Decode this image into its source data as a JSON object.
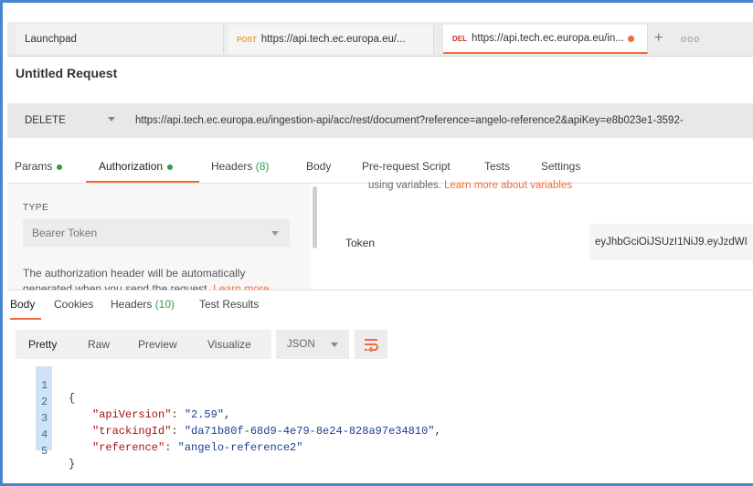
{
  "tabs": {
    "launchpad": "Launchpad",
    "post_method": "POST",
    "post_url": "https://api.tech.ec.europa.eu/...",
    "del_method": "DEL",
    "del_url": "https://api.tech.ec.europa.eu/in...",
    "new_tab_symbol": "+",
    "more_symbol": "ooo"
  },
  "request": {
    "title": "Untitled Request",
    "method": "DELETE",
    "url": "https://api.tech.ec.europa.eu/ingestion-api/acc/rest/document?reference=angelo-reference2&apiKey=e8b023e1-3592-"
  },
  "request_tabs": {
    "params": "Params",
    "authorization": "Authorization",
    "headers": "Headers",
    "headers_count": "(8)",
    "body": "Body",
    "prerequest": "Pre-request Script",
    "tests": "Tests",
    "settings": "Settings"
  },
  "auth": {
    "type_label": "TYPE",
    "type_value": "Bearer Token",
    "description": "The authorization header will be automatically generated when you send the request.",
    "description_link": "Learn more",
    "variables_text": "using variables.",
    "variables_link": "Learn more about variables",
    "token_label": "Token",
    "token_value": "eyJhbGciOiJSUzI1NiJ9.eyJzdWI"
  },
  "response_tabs": {
    "body": "Body",
    "cookies": "Cookies",
    "headers": "Headers",
    "headers_count": "(10)",
    "test_results": "Test Results"
  },
  "response_toolbar": {
    "pretty": "Pretty",
    "raw": "Raw",
    "preview": "Preview",
    "visualize": "Visualize",
    "format": "JSON"
  },
  "response_body": {
    "line_numbers": [
      "1",
      "2",
      "3",
      "4",
      "5"
    ],
    "open_brace": "{",
    "close_brace": "}",
    "fields": [
      {
        "key": "\"apiVersion\"",
        "value": "\"2.59\"",
        "sep": ",",
        "colon": ": "
      },
      {
        "key": "\"trackingId\"",
        "value": "\"da71b80f-68d9-4e79-8e24-828a97e34810\"",
        "sep": ",",
        "colon": ": "
      },
      {
        "key": "\"reference\"",
        "value": "\"angelo-reference2\"",
        "sep": "",
        "colon": ": "
      }
    ]
  },
  "colors": {
    "accent": "#f26b3a",
    "status_green": "#2e9e4f",
    "frame_blue": "#4a86c8"
  }
}
